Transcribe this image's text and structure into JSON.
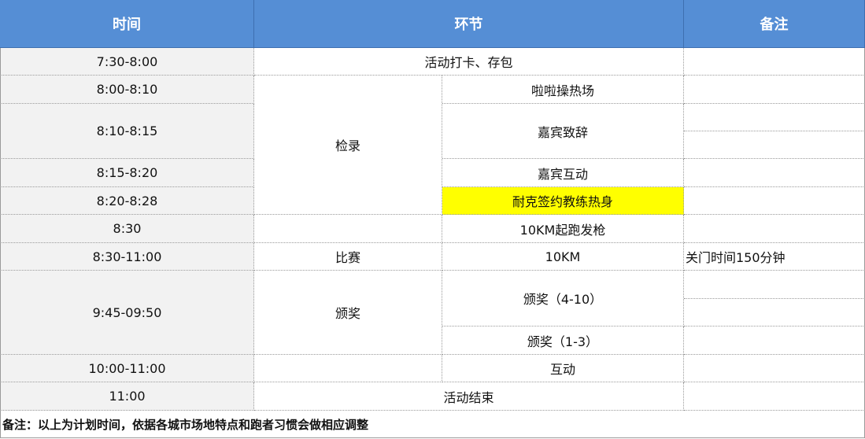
{
  "headers": {
    "time": "时间",
    "segment": "环节",
    "remarks": "备注"
  },
  "rows": {
    "r1": {
      "time": "7:30-8:00",
      "segment": "活动打卡、存包"
    },
    "r2": {
      "time": "8:00-8:10",
      "detail": "啦啦操热场"
    },
    "r3": {
      "time": "8:10-8:15",
      "detail": "嘉宾致辞"
    },
    "r4": {
      "time": "8:15-8:20",
      "detail": "嘉宾互动"
    },
    "r5": {
      "time": "8:20-8:28",
      "detail": "耐克签约教练热身"
    },
    "r6": {
      "time": "8:30",
      "detail": "10KM起跑发枪"
    },
    "r7": {
      "time": "8:30-11:00",
      "segment": "比赛",
      "detail": "10KM",
      "remark": "关门时间150分钟"
    },
    "r8": {
      "time": "9:45-09:50",
      "segment": "颁奖",
      "detail_a": "颁奖（4-10）",
      "detail_b": "颁奖（1-3）"
    },
    "r9": {
      "time": "10:00-11:00",
      "detail": "互动"
    },
    "r10": {
      "time": "11:00",
      "segment": "活动结束"
    }
  },
  "checkin_label": "检录",
  "footer_note": "备注：以上为计划时间，依据各城市场地特点和跑者习惯会做相应调整",
  "colors": {
    "header_bg": "#558ed5",
    "time_bg": "#f2f2f2",
    "highlight": "#ffff00"
  }
}
